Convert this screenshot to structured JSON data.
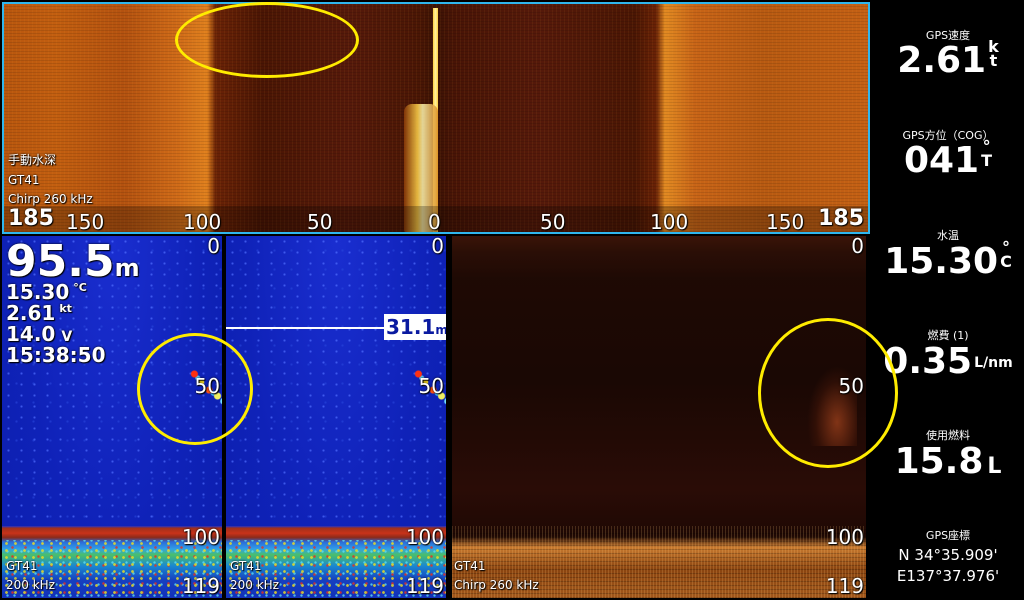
{
  "top_pane": {
    "mode_label": "手動水深",
    "transducer": "GT41",
    "frequency": "Chirp 260 kHz",
    "range_left": "185",
    "range_right": "185",
    "scale": [
      "150",
      "100",
      "50",
      "0",
      "50",
      "100",
      "150"
    ]
  },
  "left_pane": {
    "depth_value": "95.5",
    "depth_unit": "m",
    "temp_value": "15.30",
    "temp_unit": "°C",
    "speed_value": "2.61",
    "speed_unit": "kt",
    "voltage_value": "14.0",
    "voltage_unit": "V",
    "time": "15:38:50",
    "transducer": "GT41",
    "frequency": "200 kHz",
    "scale_top": "0",
    "scale_mid": "50",
    "scale_100": "100",
    "scale_bottom": "119"
  },
  "middle_pane": {
    "depth_cursor_value": "31.1",
    "depth_cursor_unit": "m",
    "transducer": "GT41",
    "frequency": "200 kHz",
    "scale_top": "0",
    "scale_mid": "50",
    "scale_100": "100",
    "scale_bottom": "119"
  },
  "right_pane": {
    "transducer": "GT41",
    "frequency": "Chirp 260 kHz",
    "scale_top": "0",
    "scale_mid": "50",
    "scale_100": "100",
    "scale_bottom": "119"
  },
  "data_panel": {
    "gps_speed_label": "GPS速度",
    "gps_speed_value": "2.61",
    "gps_speed_unit_top": "k",
    "gps_speed_unit_bottom": "t",
    "cog_label": "GPS方位（COG）",
    "cog_value": "041",
    "cog_unit_top": "°",
    "cog_unit_bottom": "T",
    "water_temp_label": "水温",
    "water_temp_value": "15.30",
    "water_temp_unit_top": "°",
    "water_temp_unit_bottom": "C",
    "fuel_economy_label": "燃費 (1)",
    "fuel_economy_value": "0.35",
    "fuel_economy_unit": "L/nm",
    "fuel_used_label": "使用燃料",
    "fuel_used_value": "15.8",
    "fuel_used_unit": "L",
    "gps_coord_label": "GPS座標",
    "latitude": "N  34°35.909'",
    "longitude": "E137°37.976'"
  },
  "colors": {
    "active_border": "#2fb6ee",
    "highlight": "#ffec00",
    "sonar_blue": "#0f22b8"
  }
}
